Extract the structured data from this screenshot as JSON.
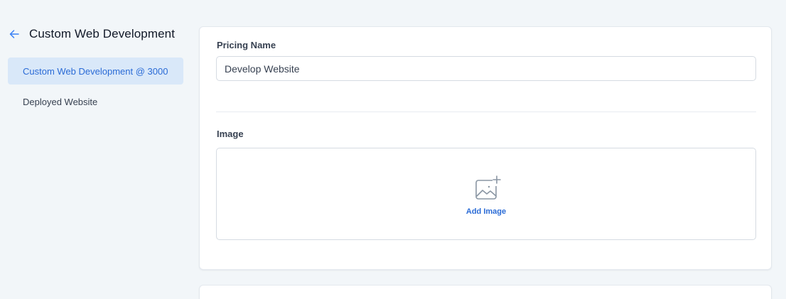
{
  "sidebar": {
    "title": "Custom Web Development",
    "items": [
      {
        "label": "Custom Web Development @ 3000",
        "active": true
      },
      {
        "label": "Deployed Website",
        "active": false
      }
    ]
  },
  "form": {
    "pricing_name": {
      "label": "Pricing Name",
      "value": "Develop Website"
    },
    "image": {
      "label": "Image",
      "add_label": "Add Image"
    }
  },
  "colors": {
    "accent": "#2a6bd6",
    "active_bg": "#d9e8f9",
    "page_bg": "#f2f6f9",
    "back_arrow": "#3b82f6"
  },
  "icons": {
    "back": "arrow-left-icon",
    "image": "image-add-icon"
  }
}
